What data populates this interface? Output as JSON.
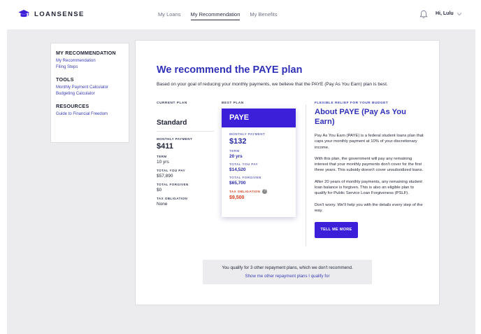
{
  "brand": {
    "name": "LOANSENSE",
    "logo_icon": "graduation-cap-icon"
  },
  "nav": {
    "items": [
      "My Loans",
      "My Recommendation",
      "My Benefits"
    ],
    "active": "My Recommendation"
  },
  "user": {
    "greeting": "Hi, Lulu",
    "bell_icon": "bell-icon",
    "chevron_icon": "chevron-down-icon"
  },
  "sidebar": {
    "sections": [
      {
        "title": "MY RECOMMENDATION",
        "links": [
          "My Recommendation",
          "Filing Steps"
        ]
      },
      {
        "title": "TOOLS",
        "links": [
          "Monthly Payment Calculator",
          "Budgeting Calculator"
        ]
      },
      {
        "title": "RESOURCES",
        "links": [
          "Guide to Financial Freedom"
        ]
      }
    ]
  },
  "main": {
    "headline": "We recommend the PAYE plan",
    "subline": "Based on your goal of reducing your monthly payments, we believe that the PAYE (Pay As You Earn) plan is best.",
    "current": {
      "label": "CURRENT PLAN",
      "name": "Standard",
      "monthly_label": "MONTHLY PAYMENT",
      "monthly": "$411",
      "term_label": "TERM",
      "term": "10 yrs",
      "total_label": "TOTAL YOU PAY",
      "total": "$57,890",
      "forgiven_label": "TOTAL FORGIVEN",
      "forgiven": "$0",
      "tax_label": "TAX OBLIGATION",
      "tax": "None"
    },
    "best": {
      "label": "BEST PLAN",
      "name": "PAYE",
      "monthly_label": "MONTHLY PAYMENT",
      "monthly": "$132",
      "term_label": "TERM",
      "term": "20 yrs",
      "total_label": "TOTAL YOU PAY",
      "total": "$14,520",
      "forgiven_label": "TOTAL FORGIVEN",
      "forgiven": "$65,700",
      "tax_label": "TAX OBLIGATION",
      "tax": "$9,500",
      "accent": "#3c1fd8",
      "tax_color": "#d83c1c"
    },
    "about": {
      "eyebrow": "FLEXIBLE RELIEF FOR YOUR BUDGET",
      "title": "About PAYE (Pay As You Earn)",
      "paragraphs": [
        "Pay As You Earn (PAYE) is a federal student loans plan that caps your monthly payment at 10% of your discretionary income.",
        "With this plan, the government will pay any remaining interest that your monthly payments don't cover for the first three years. This subsidy doesn't cover unsubsidized loans.",
        "After 20 years of monthly payments, any remaining student loan balance is forgiven. This is also an eligible plan to qualify for Public Service Loan Forgiveness (PSLF).",
        "Don't worry. We'll help you with the details every step of the way."
      ],
      "button": "TELL ME MORE"
    },
    "qualify": {
      "text": "You qualify for 3 other repayment plans, which we don't recommend.",
      "link": "Show me other repayment plans I qualify for"
    }
  }
}
